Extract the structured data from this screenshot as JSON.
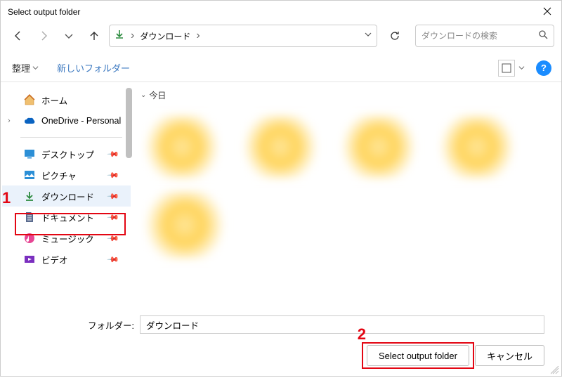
{
  "window": {
    "title": "Select output folder"
  },
  "addressbar": {
    "crumb": "ダウンロード"
  },
  "search": {
    "placeholder": "ダウンロードの検索"
  },
  "toolbar": {
    "organize": "整理",
    "newfolder": "新しいフォルダー"
  },
  "nav": {
    "home": "ホーム",
    "onedrive": "OneDrive - Personal",
    "desktop": "デスクトップ",
    "pictures": "ピクチャ",
    "downloads": "ダウンロード",
    "documents": "ドキュメント",
    "music": "ミュージック",
    "video": "ビデオ"
  },
  "group": {
    "today": "今日"
  },
  "folder_label": "フォルダー:",
  "folder_value": "ダウンロード",
  "buttons": {
    "select": "Select output folder",
    "cancel": "キャンセル"
  },
  "annotations": {
    "one": "1",
    "two": "2"
  }
}
